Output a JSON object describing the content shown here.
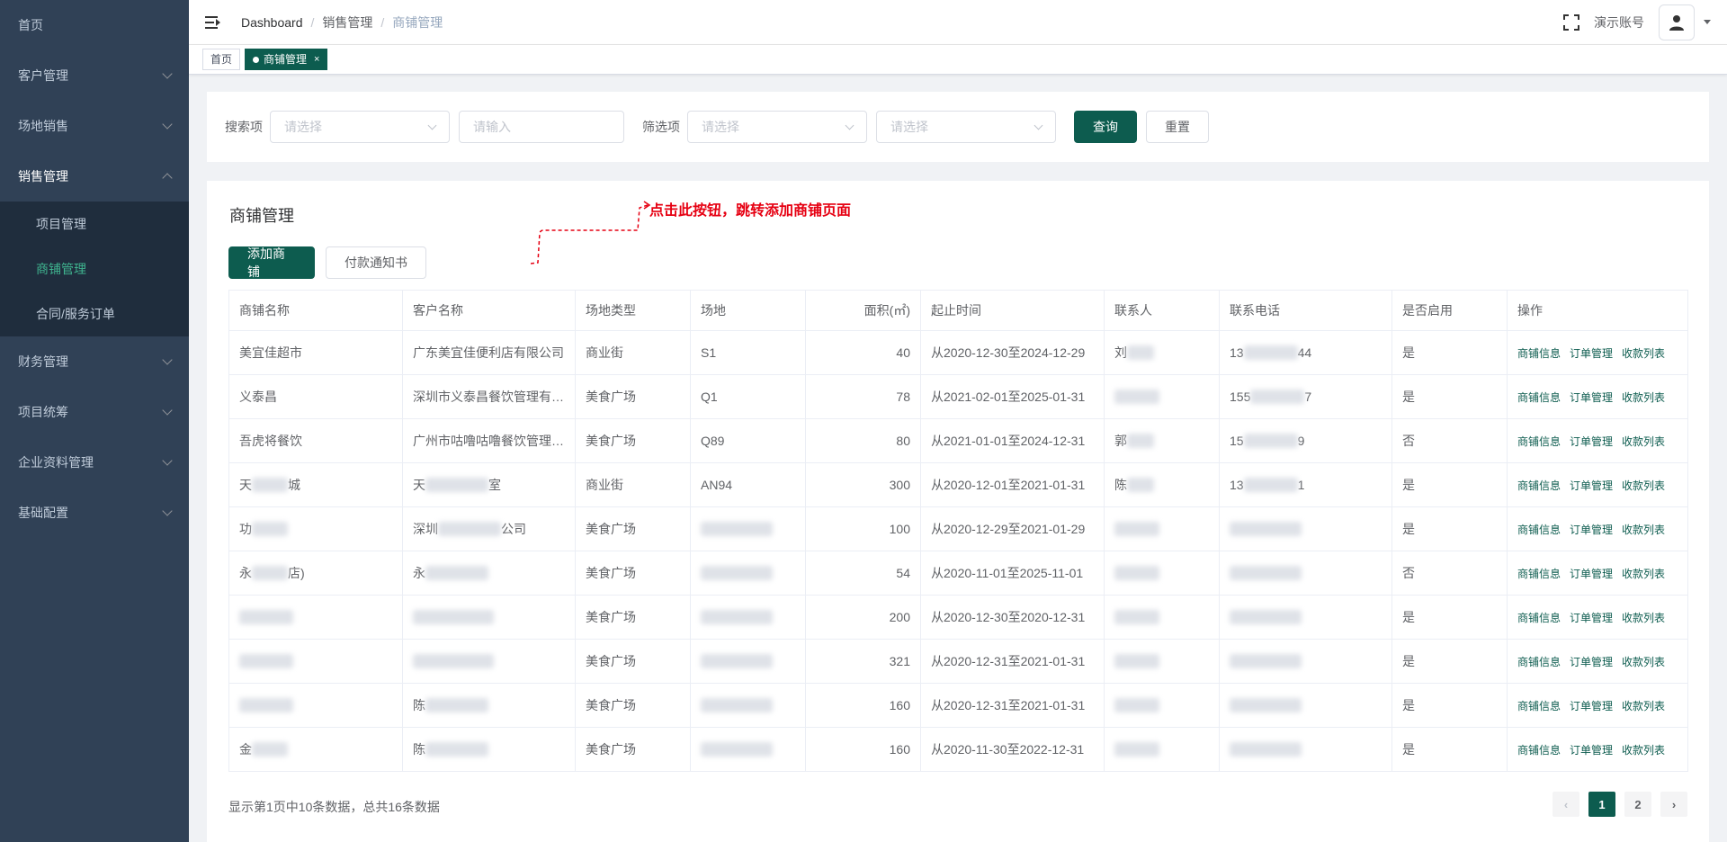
{
  "sidebar": {
    "items": [
      {
        "label": "首页"
      },
      {
        "label": "客户管理"
      },
      {
        "label": "场地销售"
      },
      {
        "label": "销售管理"
      },
      {
        "label": "财务管理"
      },
      {
        "label": "项目统筹"
      },
      {
        "label": "企业资料管理"
      },
      {
        "label": "基础配置"
      }
    ],
    "sub_items": [
      {
        "label": "项目管理"
      },
      {
        "label": "商铺管理"
      },
      {
        "label": "合同/服务订单"
      }
    ]
  },
  "navbar": {
    "breadcrumb": [
      "Dashboard",
      "销售管理",
      "商铺管理"
    ],
    "username": "演示账号"
  },
  "tags": {
    "home": "首页",
    "active": "商铺管理",
    "close": "×"
  },
  "search": {
    "label_search": "搜索项",
    "select_placeholder": "请选择",
    "input_placeholder": "请输入",
    "label_filter": "筛选项",
    "query_btn": "查询",
    "reset_btn": "重置"
  },
  "main": {
    "title": "商铺管理",
    "annotation": "点击此按钮，跳转添加商铺页面",
    "add_btn": "添加商铺",
    "notice_btn": "付款通知书",
    "columns": [
      "商铺名称",
      "客户名称",
      "场地类型",
      "场地",
      "面积(㎡)",
      "起止时间",
      "联系人",
      "联系电话",
      "是否启用",
      "操作"
    ],
    "ops": [
      "商铺信息",
      "订单管理",
      "收款列表"
    ],
    "rows": [
      {
        "name": "美宜佳超市",
        "customer": "广东美宜佳便利店有限公司",
        "type": "商业街",
        "site": "S1",
        "area": "40",
        "period": "从2020-12-30至2024-12-29",
        "contact": "刘",
        "phone": "13",
        "phone_end": "44",
        "enabled": "是"
      },
      {
        "name": "义泰昌",
        "customer": "深圳市义泰昌餐饮管理有限公司",
        "type": "美食广场",
        "site": "Q1",
        "area": "78",
        "period": "从2021-02-01至2025-01-31",
        "contact": "",
        "phone": "155",
        "phone_end": "7",
        "enabled": "是"
      },
      {
        "name": "吾虎将餐饮",
        "customer": "广州市咕噜咕噜餐饮管理有限公司",
        "type": "美食广场",
        "site": "Q89",
        "area": "80",
        "period": "从2021-01-01至2024-12-31",
        "contact": "郭",
        "phone": "15",
        "phone_end": "9",
        "enabled": "否"
      },
      {
        "name": "天",
        "name_end": "城",
        "customer": "天",
        "customer_end": "室",
        "type": "商业街",
        "site": "AN94",
        "area": "300",
        "period": "从2020-12-01至2021-01-31",
        "contact": "陈",
        "phone": "13",
        "phone_end": "1",
        "enabled": "是"
      },
      {
        "name": "功",
        "customer": "深圳",
        "customer_end": "公司",
        "type": "美食广场",
        "site": "",
        "area": "100",
        "period": "从2020-12-29至2021-01-29",
        "contact": "",
        "phone": "",
        "phone_end": "",
        "enabled": "是"
      },
      {
        "name": "永",
        "name_end": "店)",
        "customer": "永",
        "type": "美食广场",
        "site": "",
        "area": "54",
        "period": "从2020-11-01至2025-11-01",
        "contact": "",
        "phone": "",
        "phone_end": "",
        "enabled": "否"
      },
      {
        "name": "",
        "customer": "",
        "type": "美食广场",
        "site": "",
        "area": "200",
        "period": "从2020-12-30至2020-12-31",
        "contact": "",
        "phone": "",
        "phone_end": "",
        "enabled": "是"
      },
      {
        "name": "",
        "customer": "",
        "type": "美食广场",
        "site": "",
        "area": "321",
        "period": "从2020-12-31至2021-01-31",
        "contact": "",
        "phone": "",
        "phone_end": "",
        "enabled": "是"
      },
      {
        "name": "",
        "customer": "陈",
        "type": "美食广场",
        "site": "",
        "area": "160",
        "period": "从2020-12-31至2021-01-31",
        "contact": "",
        "phone": "",
        "phone_end": "",
        "enabled": "是"
      },
      {
        "name": "金",
        "customer": "陈",
        "type": "美食广场",
        "site": "",
        "area": "160",
        "period": "从2020-11-30至2022-12-31",
        "contact": "",
        "phone": "",
        "phone_end": "",
        "enabled": "是"
      }
    ],
    "pager_text": "显示第1页中10条数据，总共16条数据",
    "pages": [
      "1",
      "2"
    ],
    "prev": "‹",
    "next": "›"
  },
  "colors": {
    "accent": "#0d5c4f",
    "sidebar_bg": "#304156",
    "annotation": "#e60012"
  }
}
